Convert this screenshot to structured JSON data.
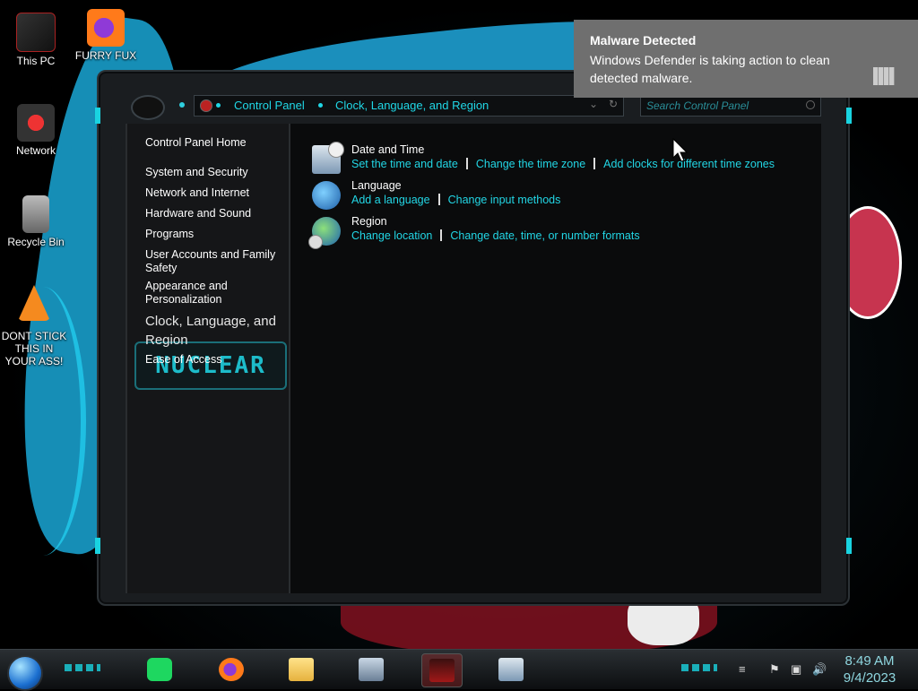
{
  "desktop": {
    "icons": [
      {
        "label": "This PC",
        "icon": "this-pc-icon"
      },
      {
        "label": "FURRY FUX",
        "icon": "firefox-icon"
      },
      {
        "label": "Network",
        "icon": "network-icon"
      },
      {
        "label": "Recycle Bin",
        "icon": "recycle-bin-icon"
      },
      {
        "label": "DONT STICK THIS IN YOUR ASS!",
        "icon": "vlc-cone-icon"
      }
    ]
  },
  "window": {
    "breadcrumb": [
      "Control Panel",
      "Clock, Language, and Region"
    ],
    "search_placeholder": "Search Control Panel",
    "sidebar": {
      "home": "Control Panel Home",
      "items": [
        "System and Security",
        "Network and Internet",
        "Hardware and Sound",
        "Programs",
        "User Accounts and Family Safety",
        "Appearance and Personalization",
        "Clock, Language, and Region",
        "Ease of Access"
      ],
      "current": "Clock, Language, and Region",
      "logo_text": "NUCLEAR"
    },
    "categories": [
      {
        "title": "Date and Time",
        "icon": "date-time-icon",
        "links": [
          "Set the time and date",
          "Change the time zone",
          "Add clocks for different time zones"
        ]
      },
      {
        "title": "Language",
        "icon": "language-icon",
        "links": [
          "Add a language",
          "Change input methods"
        ]
      },
      {
        "title": "Region",
        "icon": "region-icon",
        "links": [
          "Change location",
          "Change date, time, or number formats"
        ]
      }
    ]
  },
  "toast": {
    "title": "Malware Detected",
    "body": "Windows Defender is taking action to clean detected malware.",
    "icon": "defender-icon"
  },
  "taskbar": {
    "apps": [
      "spotify-icon",
      "firefox-icon",
      "file-explorer-icon",
      "system-monitor-icon",
      "red-app-icon",
      "date-time-icon"
    ],
    "active_app": "red-app-icon",
    "tray": [
      "action-center-flag-icon",
      "network-tray-icon",
      "volume-icon"
    ],
    "time": "8:49 AM",
    "date": "9/4/2023"
  },
  "colors": {
    "accent_cyan": "#20d7e6",
    "toast_bg": "#6f6f6f",
    "window_bg": "#0a0b0c",
    "sidebar_bg": "#151618"
  }
}
